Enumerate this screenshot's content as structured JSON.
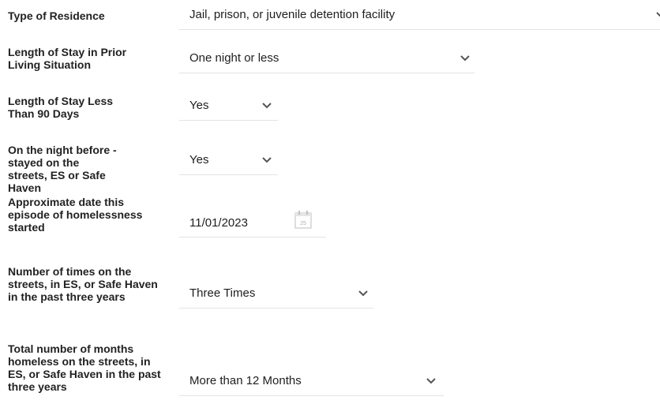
{
  "fields": [
    {
      "label": "Type of Residence",
      "value": "Jail, prison, or juvenile detention facility"
    },
    {
      "label": "Length of Stay in Prior Living Situation",
      "value": "One night or less"
    },
    {
      "label": "Length of Stay Less Than 90 Days",
      "value": "Yes"
    },
    {
      "label": "On the night before - stayed on the streets, ES or Safe Haven",
      "value": "Yes"
    },
    {
      "label": "Approximate date this episode of homelessness started",
      "value": "11/01/2023",
      "calendar_day": "25"
    },
    {
      "label": "Number of times on the streets, in ES, or Safe Haven in the past three years",
      "value": "Three Times"
    },
    {
      "label": "Total number of months homeless on the streets, in ES, or Safe Haven in the past three years",
      "value": "More than 12 Months"
    }
  ],
  "icons": {
    "dropdown": "chevron-down-icon",
    "calendar": "calendar-icon"
  },
  "colors": {
    "chevron": "#555555",
    "underline": "#e3e3e3",
    "calendar": "#c8c8c8"
  }
}
